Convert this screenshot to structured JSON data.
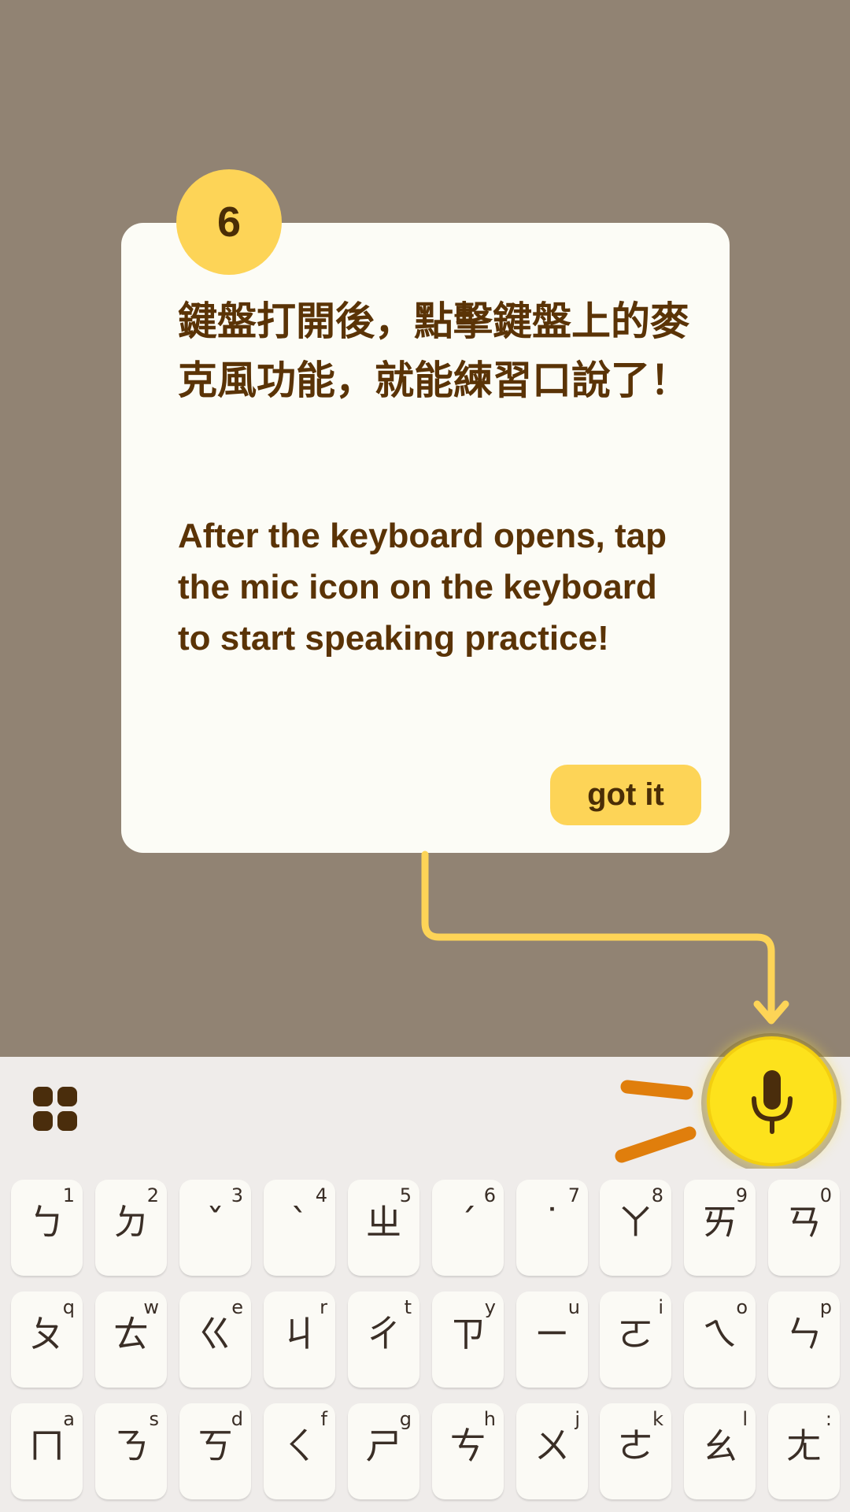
{
  "tutorial": {
    "step_number": "6",
    "title_zh": "鍵盤打開後，點擊鍵盤上的麥克風功能，就能練習口說了！",
    "body_en": "After the keyboard opens, tap the mic icon on the keyboard to start speaking practice!",
    "button_label": "got it"
  },
  "colors": {
    "overlay": "#918373",
    "card": "#fcfcf6",
    "accent_yellow": "#fdd457",
    "text_brown": "#5a3306",
    "mic_yellow": "#fde21c",
    "stroke_orange": "#e07e0c"
  },
  "keyboard": {
    "toolbar": {
      "left_icon": "apps-grid-icon",
      "right_icon": "microphone-icon"
    },
    "rows": [
      [
        {
          "main": "ㄅ",
          "hint": "1"
        },
        {
          "main": "ㄉ",
          "hint": "2"
        },
        {
          "main": "ˇ",
          "hint": "3"
        },
        {
          "main": "ˋ",
          "hint": "4"
        },
        {
          "main": "ㄓ",
          "hint": "5"
        },
        {
          "main": "ˊ",
          "hint": "6"
        },
        {
          "main": "˙",
          "hint": "7"
        },
        {
          "main": "ㄚ",
          "hint": "8"
        },
        {
          "main": "ㄞ",
          "hint": "9"
        },
        {
          "main": "ㄢ",
          "hint": "0"
        }
      ],
      [
        {
          "main": "ㄆ",
          "hint": "q"
        },
        {
          "main": "ㄊ",
          "hint": "w"
        },
        {
          "main": "ㄍ",
          "hint": "e"
        },
        {
          "main": "ㄐ",
          "hint": "r"
        },
        {
          "main": "ㄔ",
          "hint": "t"
        },
        {
          "main": "ㄗ",
          "hint": "y"
        },
        {
          "main": "ㄧ",
          "hint": "u"
        },
        {
          "main": "ㄛ",
          "hint": "i"
        },
        {
          "main": "ㄟ",
          "hint": "o"
        },
        {
          "main": "ㄣ",
          "hint": "p"
        }
      ],
      [
        {
          "main": "ㄇ",
          "hint": "a"
        },
        {
          "main": "ㄋ",
          "hint": "s"
        },
        {
          "main": "ㄎ",
          "hint": "d"
        },
        {
          "main": "ㄑ",
          "hint": "f"
        },
        {
          "main": "ㄕ",
          "hint": "g"
        },
        {
          "main": "ㄘ",
          "hint": "h"
        },
        {
          "main": "ㄨ",
          "hint": "j"
        },
        {
          "main": "ㄜ",
          "hint": "k"
        },
        {
          "main": "ㄠ",
          "hint": "l"
        },
        {
          "main": "ㄤ",
          "hint": ":"
        }
      ]
    ]
  }
}
